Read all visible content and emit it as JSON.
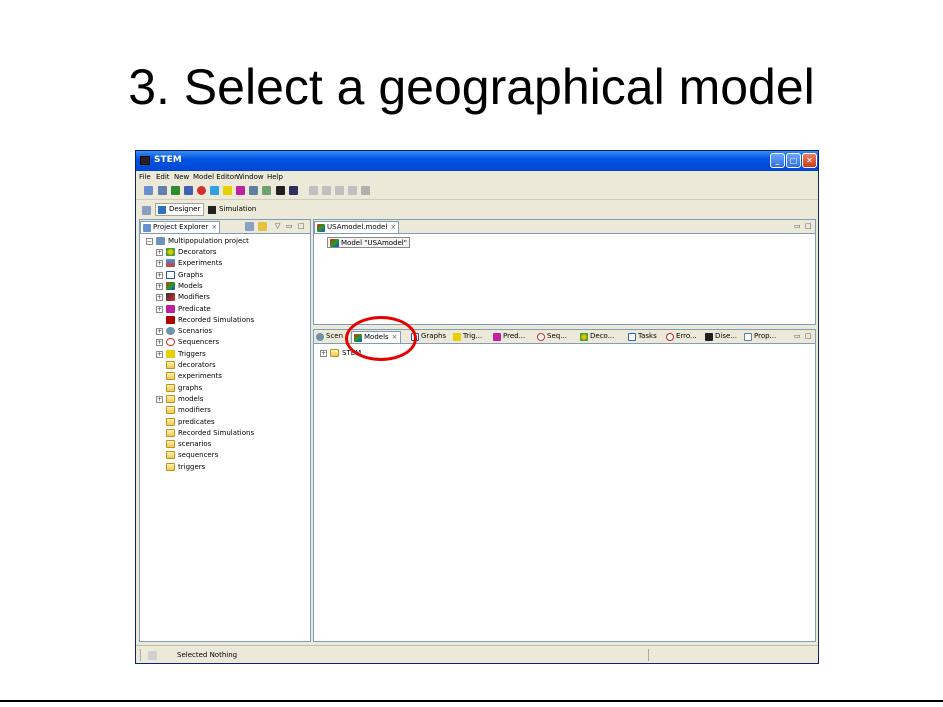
{
  "slide": {
    "title": "3. Select a geographical model"
  },
  "window": {
    "title": "STEM",
    "buttons": {
      "minimize": "_",
      "maximize": "□",
      "close": "✕"
    }
  },
  "menu": [
    "File",
    "Edit",
    "New",
    "Model Editor",
    "Window",
    "Help"
  ],
  "toolbar_icons": [
    "new-project-icon",
    "new-decorator-icon",
    "new-model-icon",
    "new-graph-icon",
    "new-sequencer-icon",
    "new-experiment-icon",
    "new-trigger-icon",
    "new-predicate-icon",
    "new-modifier-icon",
    "new-scenario-icon",
    "new-disease-icon",
    "new-population-icon",
    "run-icon",
    "pause-icon",
    "step-icon",
    "reset-icon",
    "stop-icon"
  ],
  "perspectives": {
    "designer": "Designer",
    "simulation": "Simulation"
  },
  "project_explorer": {
    "tab_label": "Project Explorer",
    "tab_close": "⨯",
    "root": "Multipopulation project",
    "items": [
      {
        "label": "Decorators",
        "expandable": true,
        "icon": "decorators-icon"
      },
      {
        "label": "Experiments",
        "expandable": true,
        "icon": "experiments-icon"
      },
      {
        "label": "Graphs",
        "expandable": true,
        "icon": "graphs-icon"
      },
      {
        "label": "Models",
        "expandable": true,
        "icon": "models-icon"
      },
      {
        "label": "Modifiers",
        "expandable": true,
        "icon": "modifiers-icon"
      },
      {
        "label": "Predicate",
        "expandable": true,
        "icon": "predicate-icon"
      },
      {
        "label": "Recorded Simulations",
        "expandable": false,
        "icon": "recorded-simulations-icon"
      },
      {
        "label": "Scenarios",
        "expandable": true,
        "icon": "scenarios-icon"
      },
      {
        "label": "Sequencers",
        "expandable": true,
        "icon": "sequencers-icon"
      },
      {
        "label": "Triggers",
        "expandable": true,
        "icon": "triggers-icon"
      },
      {
        "label": "decorators",
        "expandable": false,
        "icon": "folder-icon"
      },
      {
        "label": "experiments",
        "expandable": false,
        "icon": "folder-icon"
      },
      {
        "label": "graphs",
        "expandable": false,
        "icon": "folder-icon"
      },
      {
        "label": "models",
        "expandable": true,
        "icon": "folder-icon"
      },
      {
        "label": "modifiers",
        "expandable": false,
        "icon": "folder-icon"
      },
      {
        "label": "predicates",
        "expandable": false,
        "icon": "folder-icon"
      },
      {
        "label": "Recorded Simulations",
        "expandable": false,
        "icon": "folder-icon"
      },
      {
        "label": "scenarios",
        "expandable": false,
        "icon": "folder-icon"
      },
      {
        "label": "sequencers",
        "expandable": false,
        "icon": "folder-icon"
      },
      {
        "label": "triggers",
        "expandable": false,
        "icon": "folder-icon"
      }
    ]
  },
  "editor": {
    "tab_label": "USAmodel.model",
    "tab_close": "⨯",
    "node": "Model \"USAmodel\""
  },
  "bottom_tabs": [
    {
      "label": "Scen",
      "icon": "scenarios-icon",
      "active": false
    },
    {
      "label": "Models",
      "icon": "models-icon",
      "active": true
    },
    {
      "label": "Graphs",
      "icon": "graphs-icon",
      "active": false
    },
    {
      "label": "Trig...",
      "icon": "triggers-icon",
      "active": false
    },
    {
      "label": "Pred...",
      "icon": "predicate-icon",
      "active": false
    },
    {
      "label": "Seq...",
      "icon": "sequencers-icon",
      "active": false
    },
    {
      "label": "Deco...",
      "icon": "decorators-icon",
      "active": false
    },
    {
      "label": "Tasks",
      "icon": "tasks-icon",
      "active": false
    },
    {
      "label": "Erro...",
      "icon": "error-log-icon",
      "active": false
    },
    {
      "label": "Dise...",
      "icon": "disease-icon",
      "active": false
    },
    {
      "label": "Prop...",
      "icon": "properties-icon",
      "active": false
    }
  ],
  "models_tree": {
    "root": "STEM"
  },
  "statusbar": {
    "text": "Selected Nothing"
  },
  "colors": {
    "highlight": "#e60000",
    "titlebar": "#0054e3",
    "chrome": "#ece9d8"
  }
}
